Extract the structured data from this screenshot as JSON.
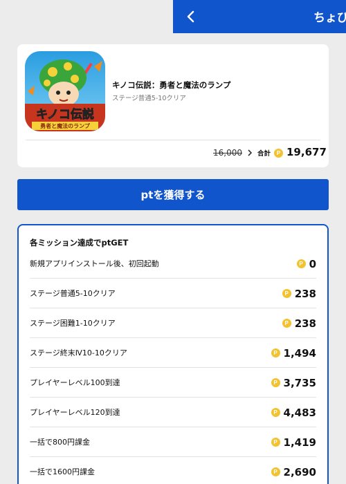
{
  "header": {
    "title": "ちょび",
    "back_icon": "chevron-left-icon",
    "color": "#1155cc"
  },
  "app": {
    "title": "キノコ伝説：勇者と魔法のランプ",
    "subtitle": "ステージ普通5-10クリア",
    "icon_text": "キノコ伝説",
    "icon_subtext": "勇者と魔法のランプ",
    "old_price": "16,000",
    "total_label": "合計",
    "coin_symbol": "P",
    "total_points": "19,677"
  },
  "cta": {
    "label": "ptを獲得する"
  },
  "missions": {
    "heading": "各ミッション達成でptGET",
    "coin_symbol": "P",
    "items": [
      {
        "label": "新規アプリインストール後、初回起動",
        "points": "0"
      },
      {
        "label": "ステージ普通5-10クリア",
        "points": "238"
      },
      {
        "label": "ステージ困難1-10クリア",
        "points": "238"
      },
      {
        "label": "ステージ終末Ⅳ10-10クリア",
        "points": "1,494"
      },
      {
        "label": "プレイヤーレベル100到達",
        "points": "3,735"
      },
      {
        "label": "プレイヤーレベル120到達",
        "points": "4,483"
      },
      {
        "label": "一括で800円課金",
        "points": "1,419"
      },
      {
        "label": "一括で1600円課金",
        "points": "2,690"
      }
    ]
  },
  "colors": {
    "accent": "#1155cc",
    "coin": "#f2c230",
    "background": "#ececec"
  }
}
